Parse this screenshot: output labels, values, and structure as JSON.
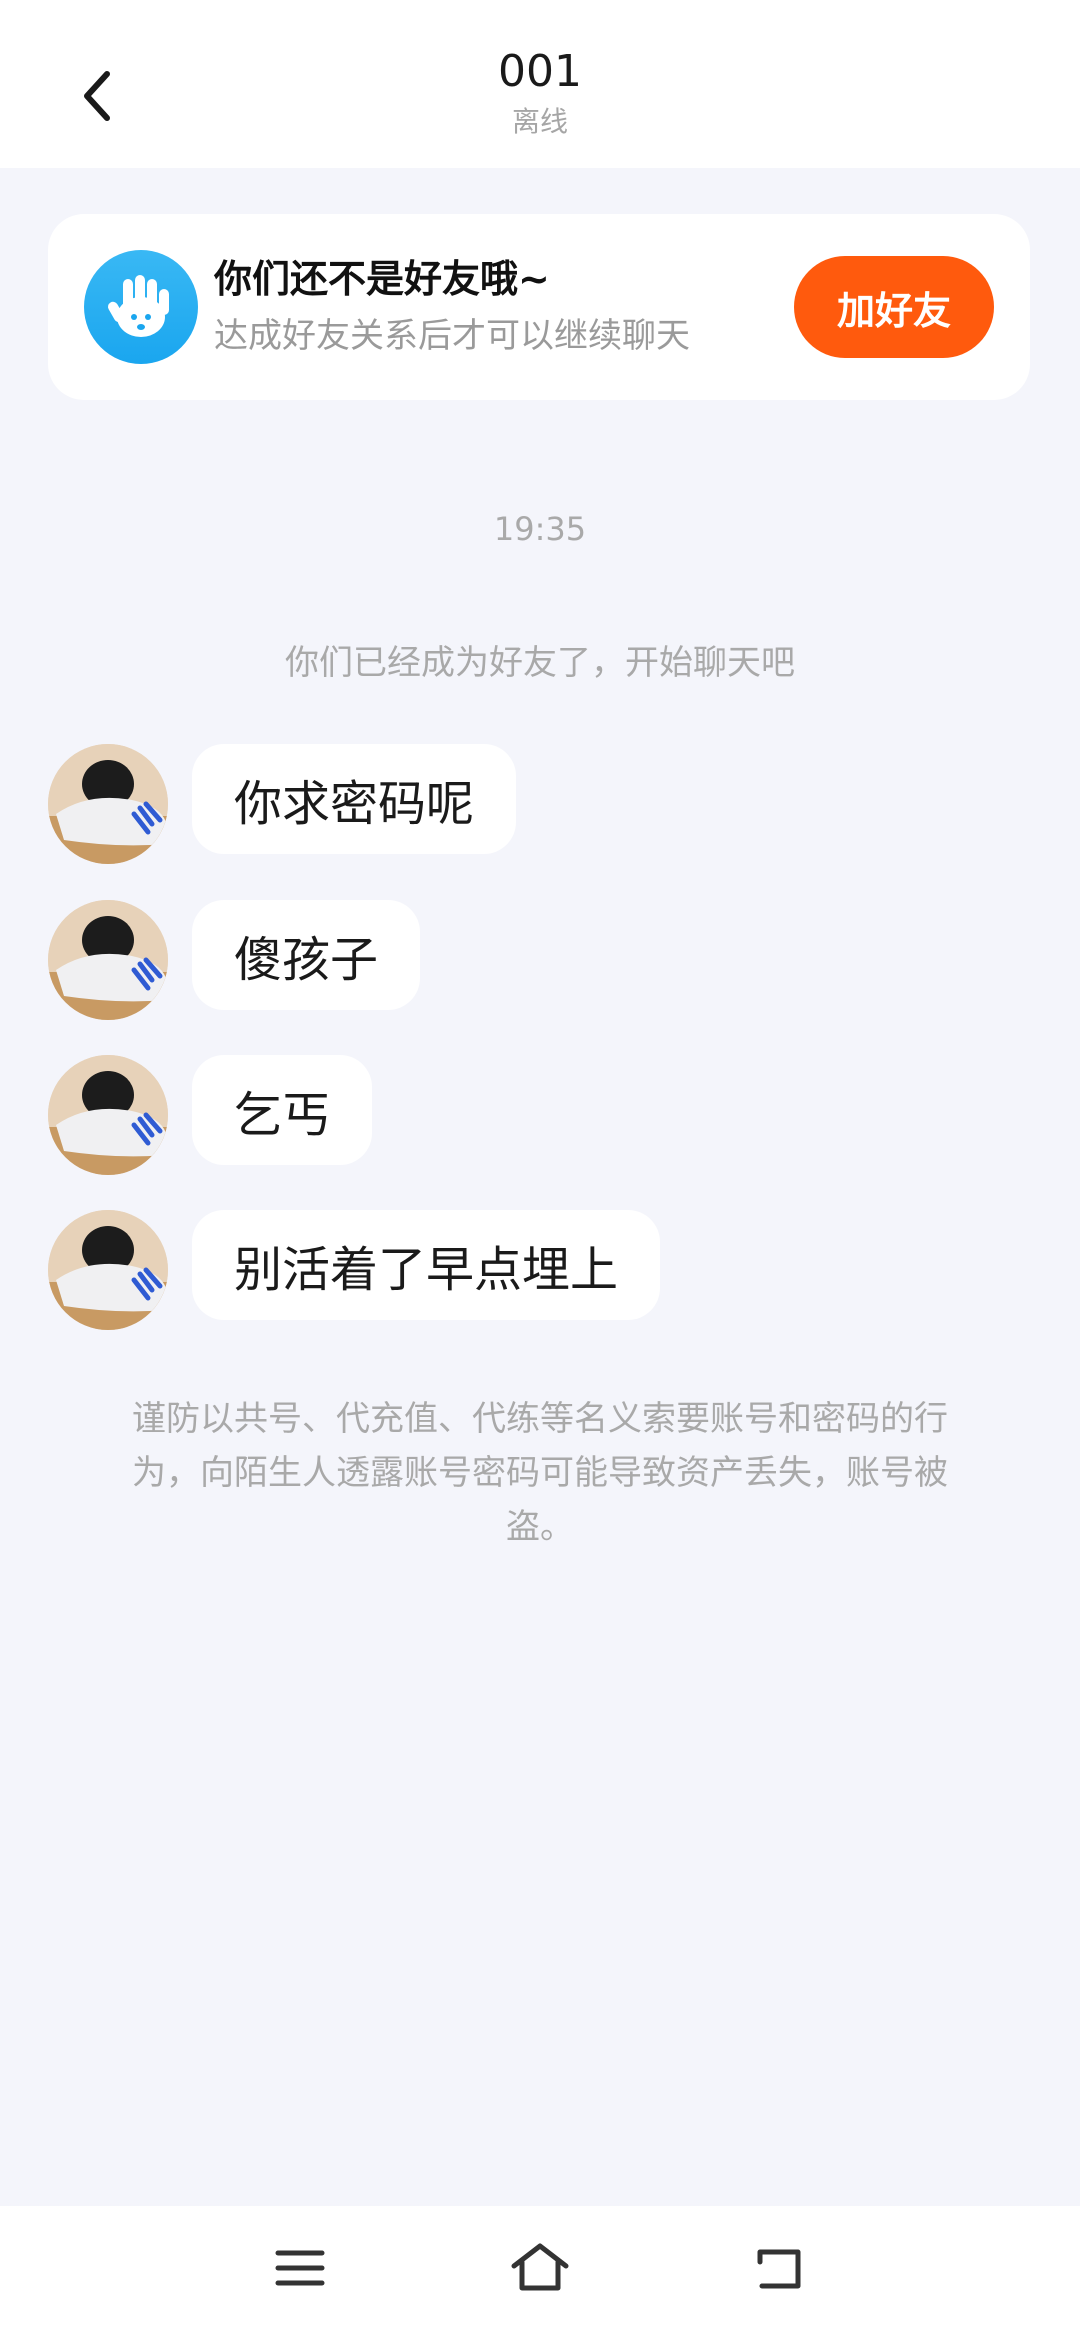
{
  "header": {
    "title": "001",
    "status": "离线"
  },
  "notice": {
    "title": "你们还不是好友哦~",
    "subtitle": "达成好友关系后才可以继续聊天",
    "button_label": "加好友"
  },
  "chat": {
    "timestamp": "19:35",
    "system_message": "你们已经成为好友了，开始聊天吧",
    "messages": [
      {
        "text": "你求密码呢"
      },
      {
        "text": "傻孩子"
      },
      {
        "text": "乞丐"
      },
      {
        "text": "别活着了早点埋上"
      }
    ],
    "warning": "谨防以共号、代充值、代练等名义索要账号和密码的行为，向陌生人透露账号密码可能导致资产丢失，账号被盗。"
  },
  "colors": {
    "background": "#f4f5fb",
    "accent": "#ff5a0d",
    "notice_icon": "#1aa6ef"
  },
  "icons": {
    "back": "chevron-left-icon",
    "notice": "hand-wave-icon",
    "nav_menu": "menu-icon",
    "nav_home": "home-icon",
    "nav_back": "return-icon"
  }
}
